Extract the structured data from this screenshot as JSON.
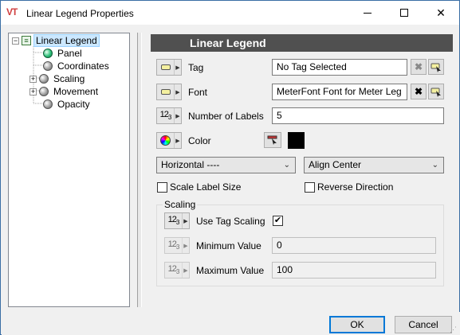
{
  "window": {
    "icon_text": "VT",
    "title": "Linear Legend Properties"
  },
  "tree": {
    "root": {
      "label": "Linear Legend",
      "expander": "−",
      "icon": "legend-icon"
    },
    "items": [
      {
        "label": "Panel",
        "status": "green"
      },
      {
        "label": "Coordinates",
        "status": "gray"
      },
      {
        "label": "Scaling",
        "status": "gray",
        "expander": "+"
      },
      {
        "label": "Movement",
        "status": "gray",
        "expander": "+"
      },
      {
        "label": "Opacity",
        "status": "gray"
      }
    ]
  },
  "panel": {
    "header": "Linear Legend",
    "tag": {
      "label": "Tag",
      "value": "No Tag Selected"
    },
    "font": {
      "label": "Font",
      "value": "MeterFont    Font for Meter Leg"
    },
    "num_labels": {
      "label": "Number of Labels",
      "value": "5"
    },
    "color": {
      "label": "Color",
      "value": "#000000"
    },
    "orientation": {
      "selected": "Horizontal ----"
    },
    "alignment": {
      "selected": "Align Center"
    },
    "scale_label_size": {
      "label": "Scale Label Size",
      "checked": false
    },
    "reverse_direction": {
      "label": "Reverse Direction",
      "checked": false
    }
  },
  "scaling": {
    "title": "Scaling",
    "use_tag_scaling": {
      "label": "Use Tag Scaling",
      "checked": true,
      "mark": "✔"
    },
    "minimum": {
      "label": "Minimum Value",
      "value": "0"
    },
    "maximum": {
      "label": "Maximum Value",
      "value": "100"
    }
  },
  "footer": {
    "ok": "OK",
    "cancel": "Cancel"
  },
  "glyphs": {
    "minimize": "",
    "close": "✕",
    "dropdown": "⌄",
    "expand_arrow": "▶",
    "clear": "✖",
    "num_main": "12",
    "num_sub": "3"
  },
  "colors": {
    "header_bg": "#505050",
    "selection": "#cce8ff",
    "accent": "#0078d7"
  }
}
